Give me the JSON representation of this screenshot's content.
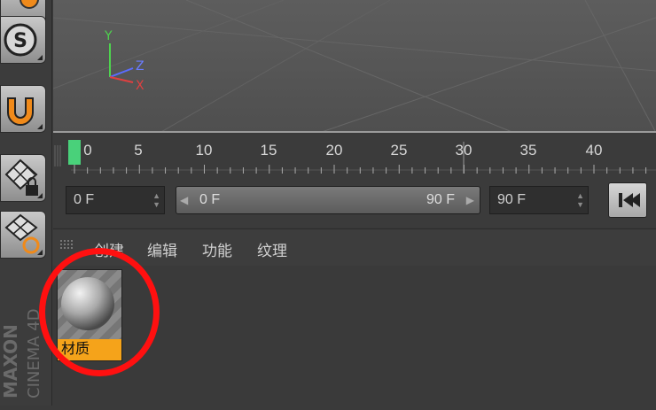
{
  "viewport": {
    "axis_labels": {
      "y": "Y",
      "z": "Z",
      "x": "X"
    }
  },
  "timeline": {
    "ticks": [
      "0",
      "5",
      "10",
      "15",
      "20",
      "25",
      "30",
      "35",
      "40"
    ],
    "current_frame": 0
  },
  "controls": {
    "start_field": "0 F",
    "range_start": "0 F",
    "range_end": "90 F",
    "end_field": "90 F"
  },
  "material_manager": {
    "menu": [
      "创建",
      "编辑",
      "功能",
      "纹理"
    ],
    "material_label": "材质"
  },
  "branding": {
    "maker": "MAXON",
    "product": "CINEMA 4D"
  },
  "colors": {
    "accent_orange": "#f5a31a",
    "timeline_marker": "#49d17a",
    "highlight": "#ff1010"
  }
}
